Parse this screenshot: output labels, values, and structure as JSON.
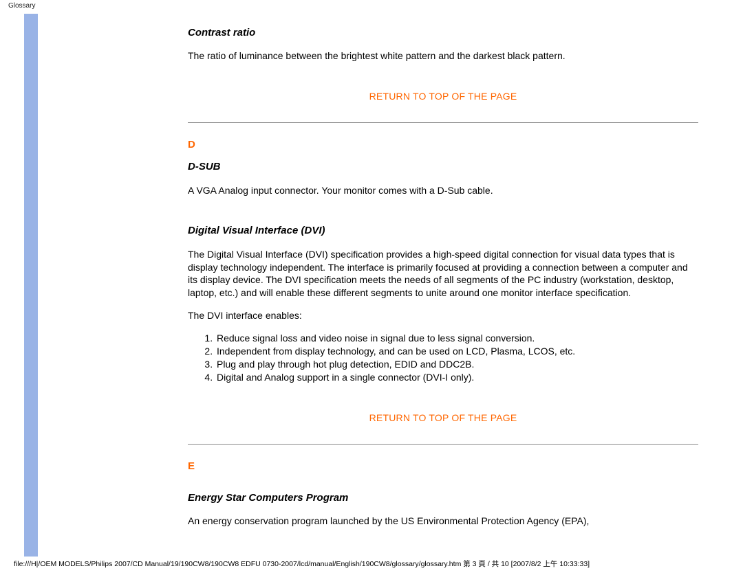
{
  "header": {
    "label": "Glossary"
  },
  "sections": {
    "contrast": {
      "heading": "Contrast ratio",
      "body": "The ratio of luminance between the brightest white pattern and the darkest black pattern."
    },
    "return1": "RETURN TO TOP OF THE PAGE",
    "letterD": "D",
    "dsub": {
      "heading": "D-SUB",
      "body": "A VGA Analog input connector. Your monitor comes with a D-Sub cable."
    },
    "dvi": {
      "heading": "Digital Visual Interface (DVI)",
      "body": "The Digital Visual Interface (DVI) specification provides a high-speed digital connection for visual data types that is display technology independent. The interface is primarily focused at providing a connection between a computer and its display device. The DVI specification meets the needs of all segments of the PC industry (workstation, desktop, laptop, etc.) and will enable these different segments to unite around one monitor interface specification.",
      "enables_intro": "The DVI interface enables:",
      "list": [
        "Reduce signal loss and video noise in signal due to less signal conversion.",
        "Independent from display technology, and can be used on LCD, Plasma, LCOS, etc.",
        "Plug and play through hot plug detection, EDID and DDC2B.",
        "Digital and Analog support in a single connector (DVI-I only)."
      ]
    },
    "return2": "RETURN TO TOP OF THE PAGE",
    "letterE": "E",
    "energystar": {
      "heading": "Energy Star Computers Program",
      "body": "An energy conservation program launched by the US Environmental Protection Agency (EPA),"
    }
  },
  "footer": "file:///H|/OEM MODELS/Philips 2007/CD Manual/19/190CW8/190CW8 EDFU 0730-2007/lcd/manual/English/190CW8/glossary/glossary.htm 第 3 頁 / 共 10 [2007/8/2 上午 10:33:33]"
}
